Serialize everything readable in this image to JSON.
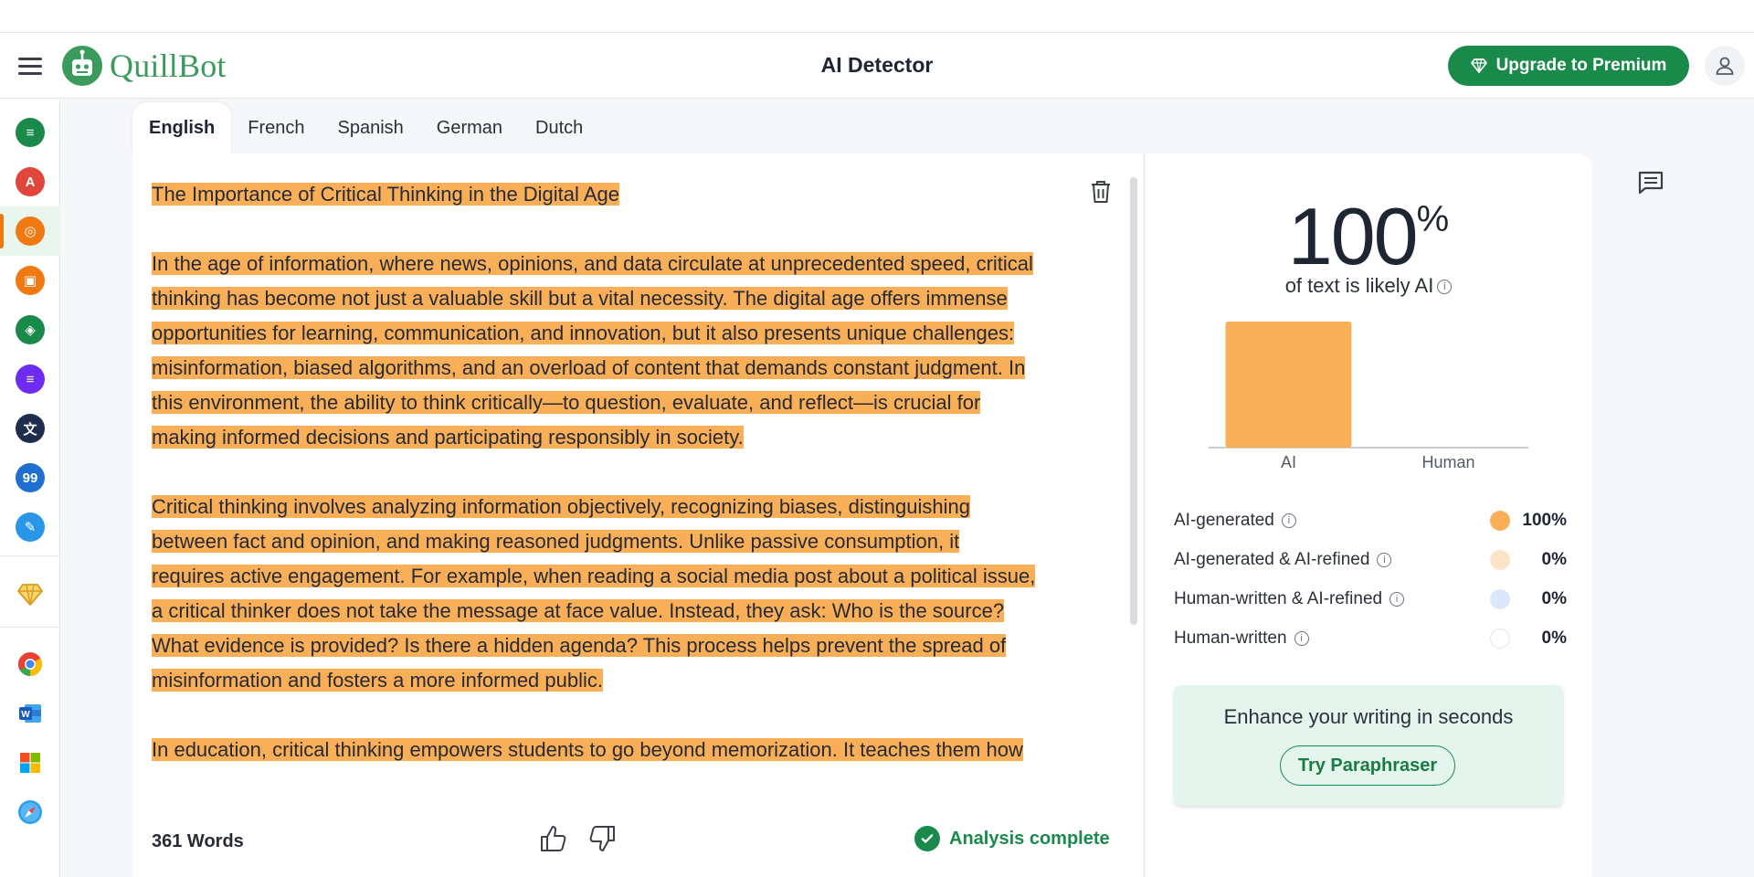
{
  "app": {
    "name": "QuillBot",
    "page_title": "AI Detector"
  },
  "header": {
    "upgrade_label": "Upgrade to Premium"
  },
  "sidebar": {
    "items": [
      {
        "name": "summarizer",
        "color": "#1a8a4a",
        "glyph": "≡"
      },
      {
        "name": "grammar-checker",
        "color": "#e0463a",
        "glyph": "A"
      },
      {
        "name": "ai-detector",
        "color": "#f07a11",
        "glyph": "◎"
      },
      {
        "name": "plagiarism-checker",
        "color": "#f07a11",
        "glyph": "▣"
      },
      {
        "name": "ai-humanizer",
        "color": "#1a8a4a",
        "glyph": "◈"
      },
      {
        "name": "summarizer-purple",
        "color": "#6d2cf0",
        "glyph": "≡"
      },
      {
        "name": "translator",
        "color": "#1f2d4d",
        "glyph": "文"
      },
      {
        "name": "citation-generator",
        "color": "#1f6fd1",
        "glyph": "99"
      },
      {
        "name": "ai-writer",
        "color": "#2a96e8",
        "glyph": "✎"
      }
    ],
    "premium_icon": "diamond-icon",
    "extensions": [
      "chrome-icon",
      "word-icon",
      "windows-icon",
      "safari-icon"
    ]
  },
  "languages": {
    "tabs": [
      "English",
      "French",
      "Spanish",
      "German",
      "Dutch"
    ],
    "active": "English"
  },
  "editor": {
    "paragraphs": [
      [
        "The Importance of Critical Thinking in the Digital Age"
      ],
      [
        "In the age of information, where news, opinions, and data circulate at unprecedented speed, critical",
        "thinking has become not just a valuable skill but a vital necessity. The digital age offers immense",
        "opportunities for learning, communication, and innovation, but it also presents unique challenges:",
        "misinformation, biased algorithms, and an overload of content that demands constant judgment. In",
        "this environment, the ability to think critically—to question, evaluate, and reflect—is crucial for",
        "making informed decisions and participating responsibly in society."
      ],
      [
        "Critical thinking involves analyzing information objectively, recognizing biases, distinguishing",
        "between fact and opinion, and making reasoned judgments. Unlike passive consumption, it",
        "requires active engagement. For example, when reading a social media post about a political issue,",
        "a critical thinker does not take the message at face value. Instead, they ask: Who is the source?",
        "What evidence is provided? Is there a hidden agenda? This process helps prevent the spread of",
        "misinformation and fosters a more informed public."
      ],
      [
        "In education, critical thinking empowers students to go beyond memorization. It teaches them how"
      ]
    ],
    "word_count": "361 Words",
    "status": "Analysis complete"
  },
  "results": {
    "percent": "100",
    "percent_sign": "%",
    "subtitle": "of text is likely AI",
    "chart_data": {
      "type": "bar",
      "categories": [
        "AI",
        "Human"
      ],
      "values": [
        100,
        0
      ],
      "ylim": [
        0,
        100
      ],
      "colors": [
        "#f9ae58",
        "#dbe7fb"
      ]
    },
    "legend": [
      {
        "label": "AI-generated",
        "value": "100%",
        "color": "#f9ae58"
      },
      {
        "label": "AI-generated & AI-refined",
        "value": "0%",
        "color": "#fbe3c8"
      },
      {
        "label": "Human-written & AI-refined",
        "value": "0%",
        "color": "#dbe7fb"
      },
      {
        "label": "Human-written",
        "value": "0%",
        "color": "#ffffff"
      }
    ],
    "promo": {
      "title": "Enhance your writing in seconds",
      "button": "Try Paraphraser"
    }
  }
}
